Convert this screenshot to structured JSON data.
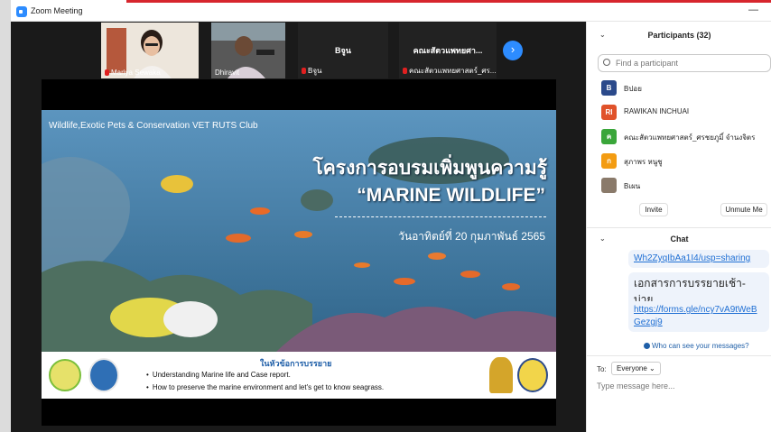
{
  "window": {
    "title": "Zoom Meeting",
    "minimize_glyph": "—"
  },
  "thumbnails": [
    {
      "name": "Mariya Sewaka",
      "large_name": "",
      "muted": true
    },
    {
      "name": "Dhiravit",
      "large_name": "",
      "muted": false
    },
    {
      "name": "Bจูน",
      "large_name": "Bจูน",
      "muted": true
    },
    {
      "name": "คณะสัตวแพทยศาสตร์_ศร...",
      "large_name": "คณะสัตวแพทยศา...",
      "muted": true
    }
  ],
  "next_icon": "chevron-right-icon",
  "slide": {
    "club": "Wildlife,Exotic Pets & Conservation VET RUTS Club",
    "title": "โครงการอบรมเพิ่มพูนความรู้",
    "subtitle": "“MARINE  WILDLIFE”",
    "date": "วันอาทิตย์ที่ 20 กุมภาพันธ์ 2565",
    "banner_heading": "ในหัวข้อการบรรยาย",
    "bullets": [
      "Understanding Marine life and Case report.",
      "How to preserve the marine environment and let's get to know seagrass."
    ]
  },
  "participants": {
    "header": "Participants (32)",
    "search_placeholder": "Find a participant",
    "list": [
      {
        "initial": "B",
        "name": "Bปอย",
        "color": "#2b4a8b"
      },
      {
        "initial": "RI",
        "name": "RAWIKAN INCHUAI",
        "color": "#e0522a"
      },
      {
        "initial": "ค",
        "name": "คณะสัตวแพทยศาสตร์_ศรชยภูมิ์ จำนงจิตร",
        "color": "#3aa63a"
      },
      {
        "initial": "ก",
        "name": "สุภาพร  หนูชู",
        "color": "#f39c12"
      },
      {
        "initial": "",
        "name": "Bเผน",
        "color": "#8a7a6a"
      }
    ],
    "invite_label": "Invite",
    "unmute_label": "Unmute Me"
  },
  "chat": {
    "header": "Chat",
    "messages": [
      {
        "text": "Wh2ZyqIbAa1I4/usp=sharing",
        "kind": "link"
      },
      {
        "text": "เอกสารการบรรยายเช้า-บ่าย",
        "kind": "text"
      },
      {
        "text": "https://forms.gle/ncy7vA9tWeBGezgj9",
        "kind": "link"
      }
    ],
    "who_can_see": "Who can see your messages?",
    "to_label": "To:",
    "recipient": "Everyone ⌄",
    "input_placeholder": "Type message here..."
  },
  "colors": {
    "zoom_blue": "#2d8cff",
    "mute_red": "#e02020",
    "link_blue": "#1f6fd4"
  }
}
